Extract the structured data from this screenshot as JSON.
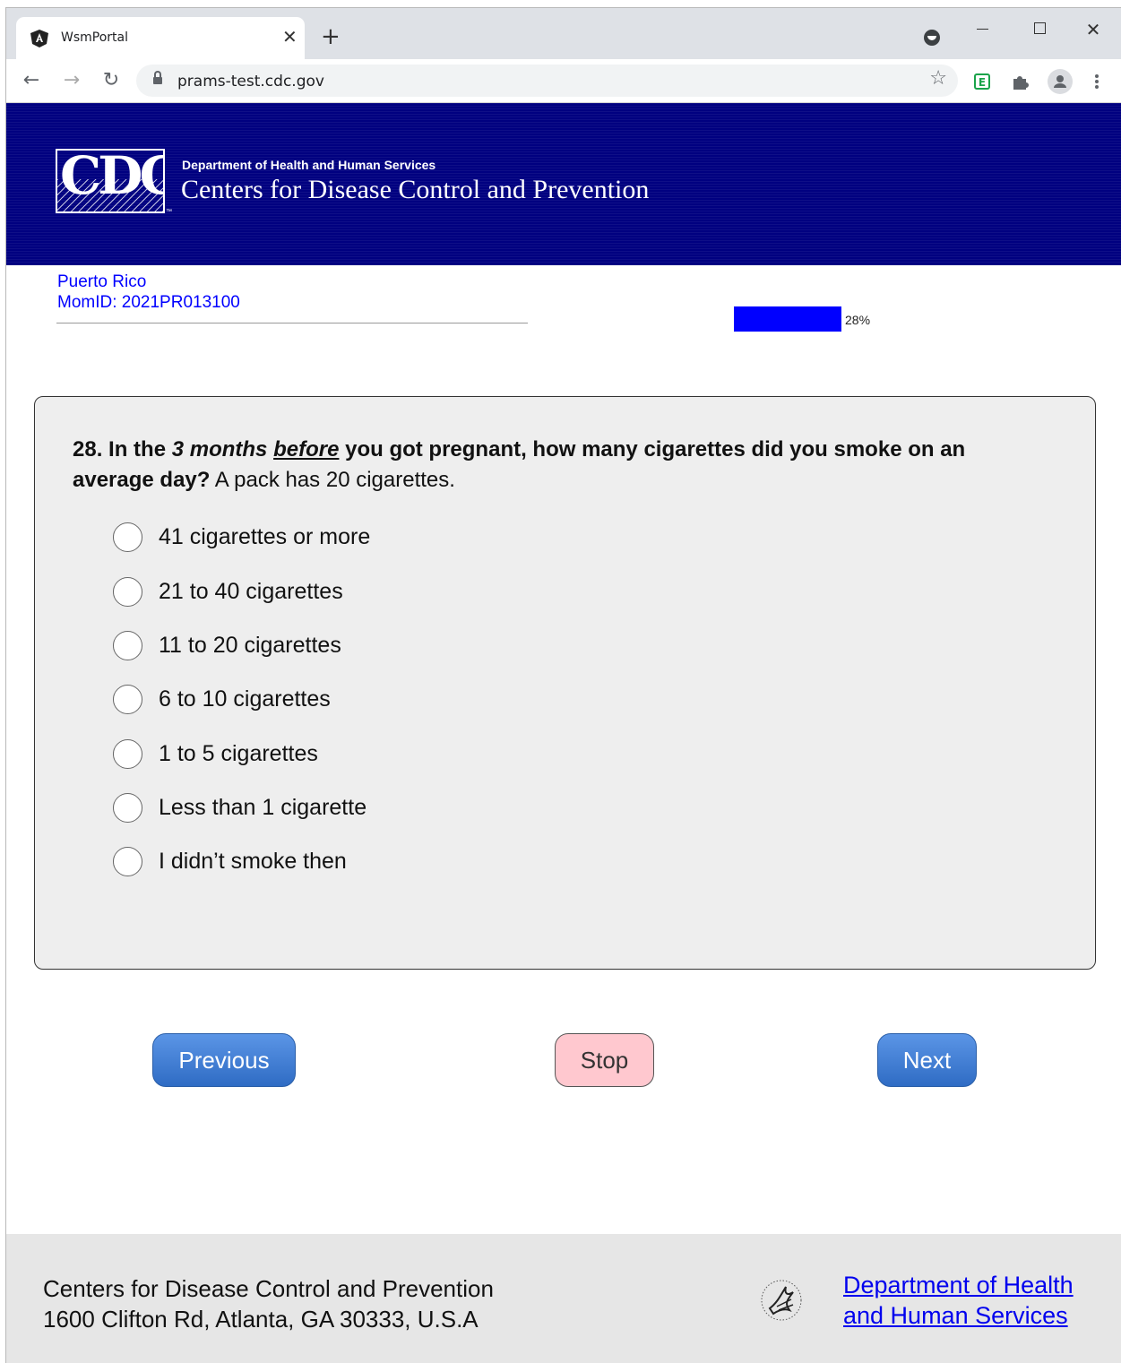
{
  "browser": {
    "tab_title": "WsmPortal",
    "url": "prams-test.cdc.gov"
  },
  "banner": {
    "logo_text": "CDC",
    "dept_small": "Department of Health and Human Services",
    "dept_large": "Centers for Disease Control and Prevention"
  },
  "respondent": {
    "state": "Puerto Rico",
    "mom_id": "MomID: 2021PR013100"
  },
  "progress": {
    "percent": 28,
    "label": "28%"
  },
  "question": {
    "number": "28.",
    "part1": "In the ",
    "italic": "3 months",
    "underlined": "before",
    "part2": " you got pregnant, how many cigarettes did you smoke on an average day?",
    "note": " A pack has 20 cigarettes.",
    "options": [
      "41 cigarettes or more",
      "21 to 40 cigarettes",
      "11 to 20 cigarettes",
      "6 to 10 cigarettes",
      "1 to 5 cigarettes",
      "Less than 1 cigarette",
      "I didn’t smoke then"
    ]
  },
  "buttons": {
    "previous": "Previous",
    "stop": "Stop",
    "next": "Next"
  },
  "footer": {
    "org": "Centers for Disease Control and Prevention",
    "address": "1600 Clifton Rd, Atlanta, GA 30333, U.S.A",
    "hhs_link_line1": "Department of Health",
    "hhs_link_line2": "and Human Services"
  },
  "colors": {
    "banner": "#000080",
    "progress_fill": "#0000ff",
    "blue_button": "#3d7ad6",
    "stop_button": "#ffc8cf"
  }
}
